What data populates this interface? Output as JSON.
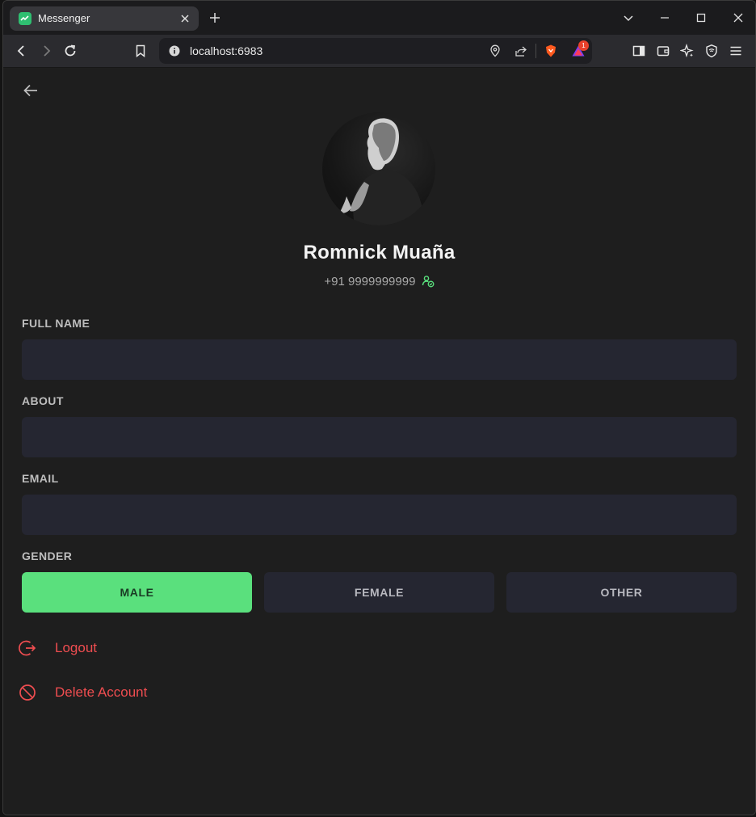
{
  "browser": {
    "tab_title": "Messenger",
    "url": "localhost:6983",
    "notification_count": "1"
  },
  "profile": {
    "name": "Romnick Muaña",
    "phone": "+91 9999999999"
  },
  "form": {
    "full_name": {
      "label": "FULL NAME",
      "value": ""
    },
    "about": {
      "label": "ABOUT",
      "value": ""
    },
    "email": {
      "label": "EMAIL",
      "value": ""
    },
    "gender": {
      "label": "GENDER",
      "options": [
        "MALE",
        "FEMALE",
        "OTHER"
      ],
      "selected": "MALE"
    }
  },
  "actions": {
    "logout": "Logout",
    "delete_account": "Delete Account"
  },
  "colors": {
    "accent_green": "#5ae07d",
    "danger_red": "#ef4d50",
    "input_bg": "#252631"
  }
}
